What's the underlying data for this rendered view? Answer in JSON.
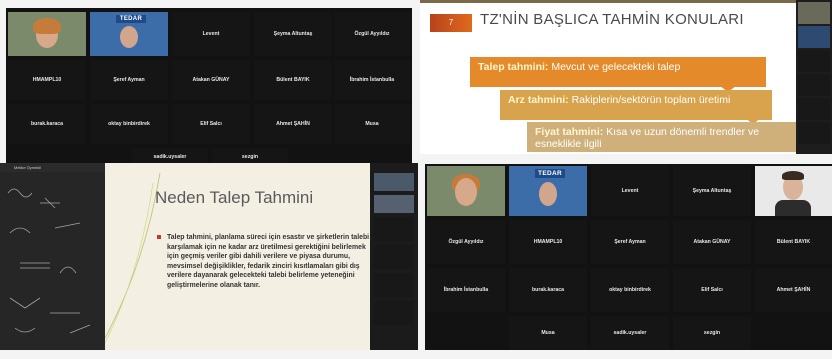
{
  "top_left_grid": {
    "row1": [
      {
        "name": "",
        "label": "",
        "video": "woman"
      },
      {
        "name": "",
        "label": "",
        "video": "logo"
      },
      {
        "name": "Levent",
        "label": ""
      },
      {
        "name": "Şeyma Altuntaş",
        "label": ""
      },
      {
        "name": "Özgül Ayyıldız",
        "label": ""
      }
    ],
    "row2": [
      {
        "name": "HMAMPL10",
        "label": ""
      },
      {
        "name": "Şeref Ayman",
        "label": ""
      },
      {
        "name": "Atakan GÜNAY",
        "label": ""
      },
      {
        "name": "Bülent BAYIK",
        "label": ""
      },
      {
        "name": "İbrahim İstanbulla",
        "label": ""
      }
    ],
    "row3": [
      {
        "name": "burak.karaca",
        "label": ""
      },
      {
        "name": "oktay binbirdirek",
        "label": ""
      },
      {
        "name": "Elif Salcı",
        "label": ""
      },
      {
        "name": "Ahmet ŞAHİN",
        "label": ""
      },
      {
        "name": "Musa",
        "label": ""
      }
    ],
    "row4": [
      {
        "name": "sadik.uysaler",
        "label": ""
      },
      {
        "name": "sezgin",
        "label": ""
      }
    ],
    "logo_text": "TEDAR"
  },
  "slide1": {
    "tag": "7",
    "title": "TZ'NİN BAŞLICA TAHMİN KONULARI",
    "steps": [
      {
        "head": "Talep tahmini:",
        "text": " Mevcut ve gelecekteki talep"
      },
      {
        "head": "Arz tahmini:",
        "text": " Rakiplerin/sektörün toplam üretimi"
      },
      {
        "head": "Fiyat tahmini:",
        "text": " Kısa ve uzun dönemli trendler ve esneklikle ilgili"
      }
    ]
  },
  "slide2": {
    "presenter": "Melike Öymekli",
    "title": "Neden Talep Tahmini",
    "body": "Talep tahmini, planlama süreci için esastır ve şirketlerin talebi karşılamak için ne kadar arz üretilmesi gerektiğini belirlemek için geçmiş veriler gibi dahili verilere ve piyasa durumu, mevsimsel değişiklikler, fedarik zinciri kısıtlamaları gibi dış verilere dayanarak gelecekteki talebi belirleme yeteneğini geliştirmelerine olanak tanır."
  },
  "bottom_right_grid": {
    "row1": [
      {
        "name": "",
        "video": "woman"
      },
      {
        "name": "",
        "video": "logo"
      },
      {
        "name": "Levent"
      },
      {
        "name": "Şeyma Altuntaş"
      },
      {
        "name": "",
        "video": "man"
      }
    ],
    "row2": [
      {
        "name": "Özgül Ayyıldız"
      },
      {
        "name": "HMAMPL10"
      },
      {
        "name": "Şeref Ayman"
      },
      {
        "name": "Atakan GÜNAY"
      },
      {
        "name": "Bülent BAYIK"
      }
    ],
    "row3": [
      {
        "name": "İbrahim İstanbulla"
      },
      {
        "name": "burak.karaca"
      },
      {
        "name": "oktay binbirdirek"
      },
      {
        "name": "Elif Salcı"
      },
      {
        "name": "Ahmet ŞAHİN"
      }
    ],
    "row4": [
      {
        "name": "Musa"
      },
      {
        "name": "sadik.uysaler"
      },
      {
        "name": "sezgin"
      }
    ],
    "logo_text": "TEDAR"
  }
}
